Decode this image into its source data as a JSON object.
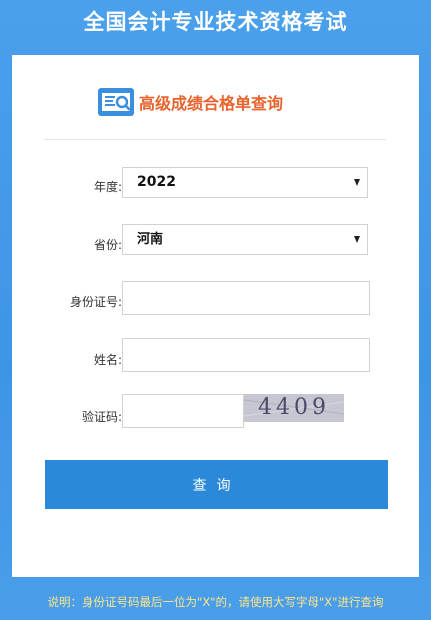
{
  "header": {
    "title": "全国会计专业技术资格考试"
  },
  "card": {
    "title": "高级成绩合格单查询",
    "fields": {
      "year": {
        "label": "年度:",
        "value": "2022"
      },
      "province": {
        "label": "省份:",
        "value": "河南"
      },
      "id": {
        "label": "身份证号:",
        "value": ""
      },
      "name": {
        "label": "姓名:",
        "value": ""
      },
      "captcha": {
        "label": "验证码:",
        "value": "",
        "image_text": "4409"
      }
    },
    "submit_label": "查询"
  },
  "footer": {
    "note": "说明：身份证号码最后一位为\"X\"的，请使用大写字母\"X\"进行查询"
  },
  "colors": {
    "accent": "#2c88d8",
    "title_orange": "#e8622c",
    "note_yellow": "#fde58a"
  },
  "icons": {
    "logo": "search-document-icon",
    "dropdown": "caret-down-icon"
  }
}
